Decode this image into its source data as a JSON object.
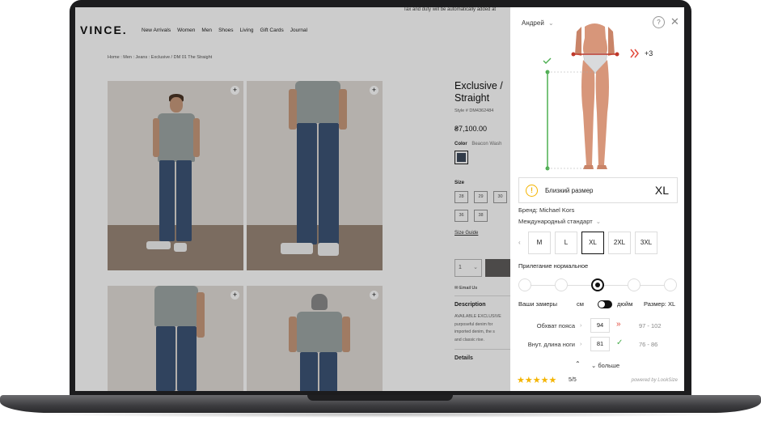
{
  "site": {
    "top_note": "Tax and duty will be automatically added at",
    "logo": "VINCE.",
    "nav": [
      "New Arrivals",
      "Women",
      "Men",
      "Shoes",
      "Living",
      "Gift Cards",
      "Journal"
    ],
    "breadcrumb": "Home : Men : Jeans : Exclusive / DM 01 The Straight",
    "product": {
      "title_line1": "Exclusive /",
      "title_line2": "Straight",
      "style": "Style # DM4362484",
      "price": "₴7,100.00",
      "color_label": "Color",
      "color_value": "Beacon Wash",
      "size_label": "Size",
      "sizes": [
        "28",
        "29",
        "30",
        "36",
        "38"
      ],
      "size_guide": "Size Guide",
      "qty": "1",
      "email_us": "Email Us",
      "description_heading": "Description",
      "description_lines": [
        "AVAILABLE EXCLUSIVE",
        "purposeful denim for",
        "imported denim, the s",
        "and classic rise."
      ],
      "details": "Details"
    }
  },
  "panel": {
    "user": "Андрей",
    "help": "?",
    "close": "✕",
    "overflow_label": "+3",
    "fit_result": {
      "text": "Близкий размер",
      "size": "XL",
      "warn_glyph": "!"
    },
    "brand_label": "Бренд:",
    "brand": "Michael Kors",
    "standard": "Международный стандарт",
    "sizes": [
      "M",
      "L",
      "XL",
      "2XL",
      "3XL"
    ],
    "selected_size_index": 2,
    "fit_label": "Прилегание нормальное",
    "slider_positions": 5,
    "slider_selected_index": 2,
    "measurements_label": "Ваши замеры",
    "unit_cm": "см",
    "unit_inch": "дюйм",
    "size_label": "Размер: XL",
    "rows": [
      {
        "label": "Обхват пояса",
        "value": "94",
        "range": "97 - 102",
        "status": "tight"
      },
      {
        "label": "Внут. длина ноги",
        "value": "81",
        "range": "76 - 86",
        "status": "ok"
      }
    ],
    "more": "больше",
    "rating": "5/5",
    "stars": 5,
    "powered_by": "powered by LookSize",
    "colors": {
      "tight": "#e2493b",
      "ok": "#4caf50",
      "star": "#f4b400",
      "warn": "#f4b400"
    }
  }
}
